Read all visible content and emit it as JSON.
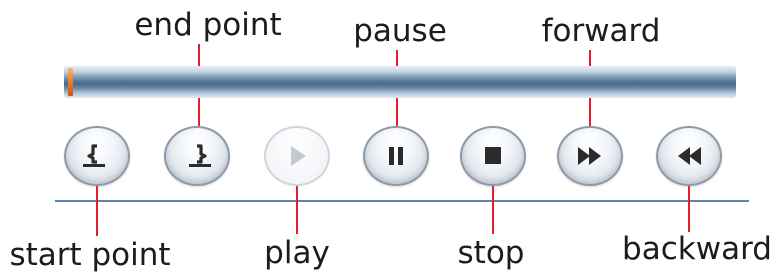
{
  "labels": {
    "end_point": "end point",
    "pause": "pause",
    "forward": "forward",
    "start_point": "start point",
    "play": "play",
    "stop": "stop",
    "backward": "backward"
  },
  "icons": [
    "start-point-icon",
    "end-point-icon",
    "play-icon",
    "pause-icon",
    "stop-icon",
    "forward-icon",
    "backward-icon"
  ],
  "colors": {
    "pointer_line": "#e0202a",
    "icon": "#2b2b2b",
    "icon_disabled": "#c4c9cf",
    "position_marker": "#f07a22",
    "divider": "#5f82b6"
  },
  "playback_position": 0.0,
  "play_enabled": false
}
